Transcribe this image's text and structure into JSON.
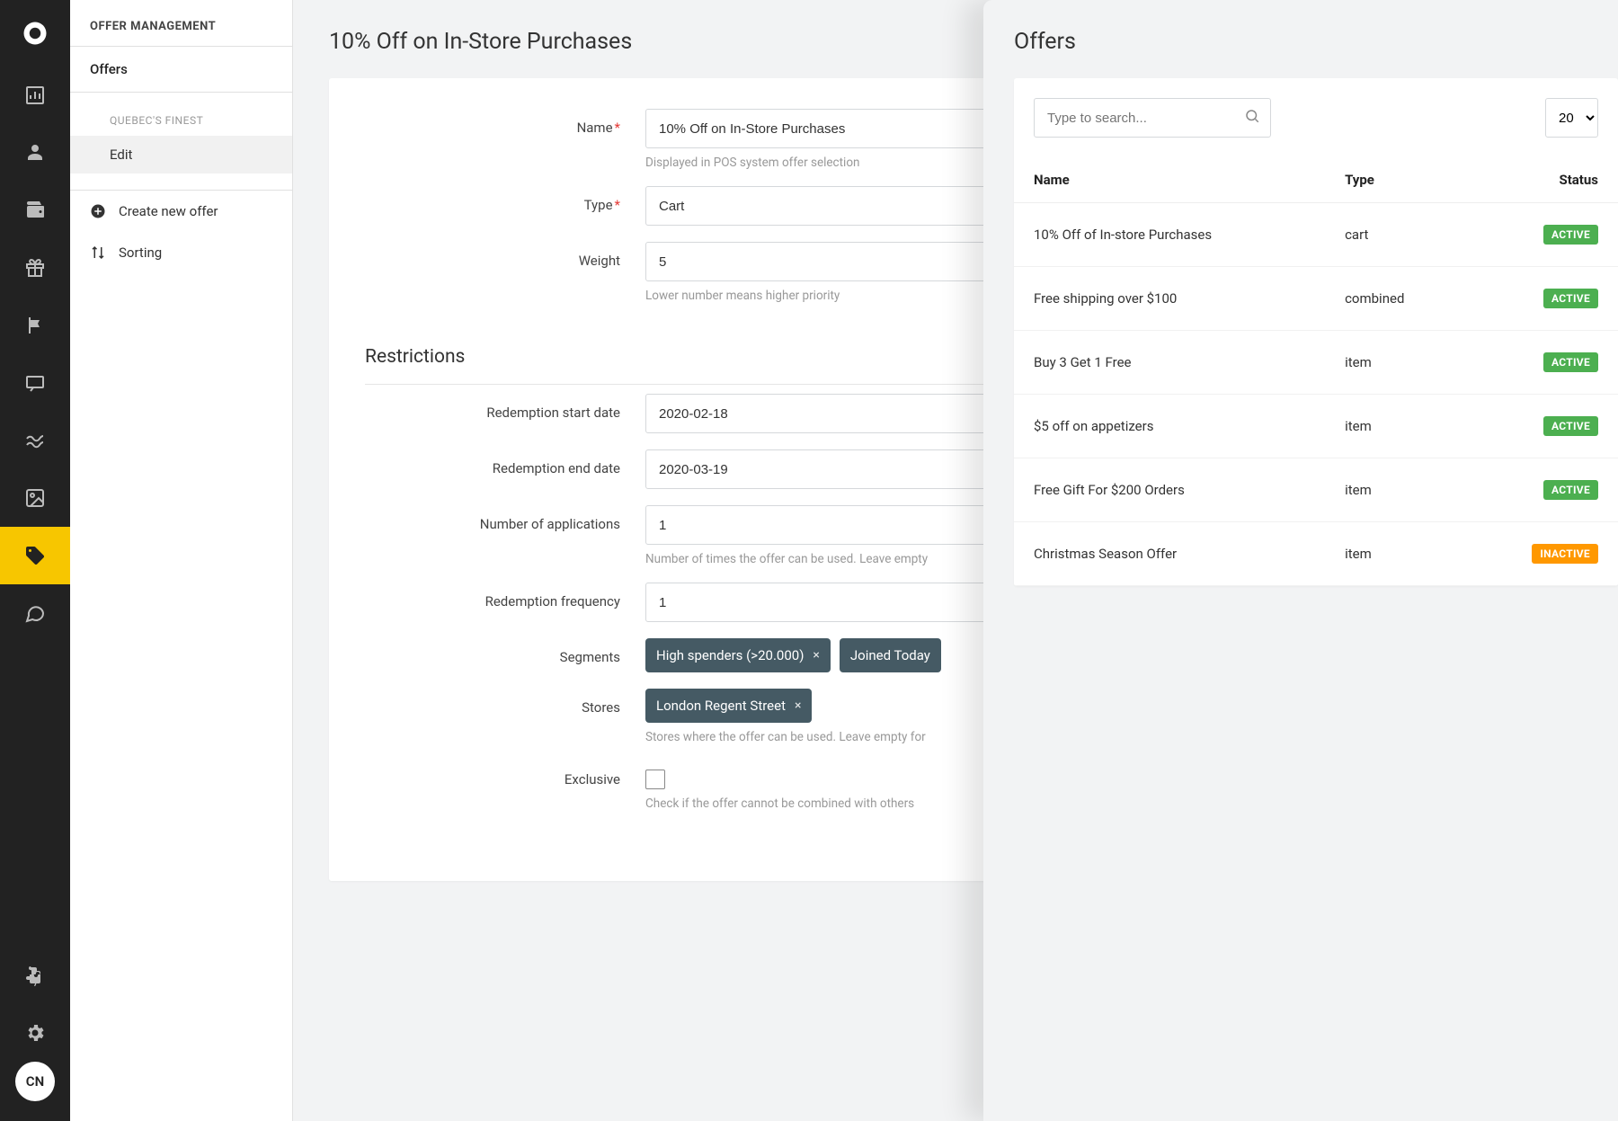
{
  "sidebar": {
    "header": "OFFER MANAGEMENT",
    "items": {
      "offers": "Offers",
      "category": "QUEBEC'S FINEST",
      "edit": "Edit",
      "create": "Create new offer",
      "sorting": "Sorting"
    }
  },
  "rail": {
    "avatar": "CN"
  },
  "page": {
    "title": "10% Off on In-Store Purchases"
  },
  "form": {
    "name_label": "Name",
    "name_value": "10% Off on In-Store Purchases",
    "name_help": "Displayed in POS system offer selection",
    "type_label": "Type",
    "type_value": "Cart",
    "weight_label": "Weight",
    "weight_value": "5",
    "weight_help": "Lower number means higher priority",
    "restrictions_title": "Restrictions",
    "start_label": "Redemption start date",
    "start_value": "2020-02-18",
    "end_label": "Redemption end date",
    "end_value": "2020-03-19",
    "apps_label": "Number of applications",
    "apps_value": "1",
    "apps_help": "Number of times the offer can be used. Leave empty",
    "freq_label": "Redemption frequency",
    "freq_value": "1",
    "segments_label": "Segments",
    "segments": [
      "High spenders (>20.000)",
      "Joined Today"
    ],
    "stores_label": "Stores",
    "stores": [
      "London Regent Street"
    ],
    "stores_help": "Stores where the offer can be used. Leave empty for",
    "exclusive_label": "Exclusive",
    "exclusive_help": "Check if the offer cannot be combined with others"
  },
  "right": {
    "title": "Offers",
    "search_placeholder": "Type to search...",
    "page_size": "20",
    "columns": {
      "name": "Name",
      "type": "Type",
      "status": "Status"
    },
    "rows": [
      {
        "name": "10% Off of In-store Purchases",
        "type": "cart",
        "status": "ACTIVE",
        "active": true
      },
      {
        "name": "Free shipping over $100",
        "type": "combined",
        "status": "ACTIVE",
        "active": true
      },
      {
        "name": "Buy 3 Get 1 Free",
        "type": "item",
        "status": "ACTIVE",
        "active": true
      },
      {
        "name": "$5 off on appetizers",
        "type": "item",
        "status": "ACTIVE",
        "active": true
      },
      {
        "name": "Free Gift For $200 Orders",
        "type": "item",
        "status": "ACTIVE",
        "active": true
      },
      {
        "name": "Christmas Season Offer",
        "type": "item",
        "status": "INACTIVE",
        "active": false
      }
    ]
  }
}
